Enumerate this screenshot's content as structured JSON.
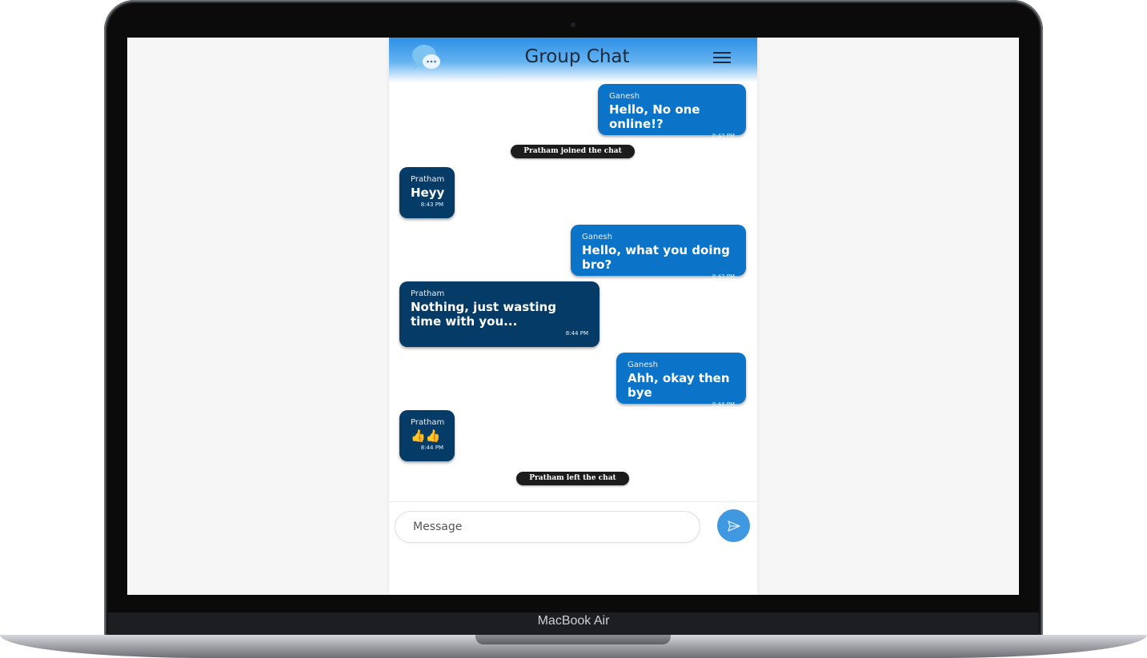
{
  "device": {
    "brand": "MacBook Air"
  },
  "header": {
    "title": "Group Chat"
  },
  "messages": [
    {
      "sender": "Ganesh",
      "text": "Hello, No one online!?",
      "time": "8:43 PM"
    },
    {
      "notice": "Pratham joined the chat"
    },
    {
      "sender": "Pratham",
      "text": "Heyy",
      "time": "8:43 PM"
    },
    {
      "sender": "Ganesh",
      "text": "Hello, what you doing bro?",
      "time": "8:43 PM"
    },
    {
      "sender": "Pratham",
      "text": "Nothing, just wasting time with you...",
      "time": "8:44 PM"
    },
    {
      "sender": "Ganesh",
      "text": "Ahh, okay then bye",
      "time": "8:44 PM"
    },
    {
      "sender": "Pratham",
      "text": "👍👍",
      "time": "8:44 PM"
    },
    {
      "notice": "Pratham left the chat"
    }
  ],
  "composer": {
    "placeholder": "Message"
  },
  "icons": {
    "logo": "chat-bubble-icon",
    "menu": "hamburger-menu-icon",
    "send": "send-arrow-icon"
  },
  "colors": {
    "outgoing_bubble": "#0c74c8",
    "incoming_bubble": "#053b67",
    "send_button": "#3f98e0",
    "notice_bg": "#1c1c1c"
  }
}
